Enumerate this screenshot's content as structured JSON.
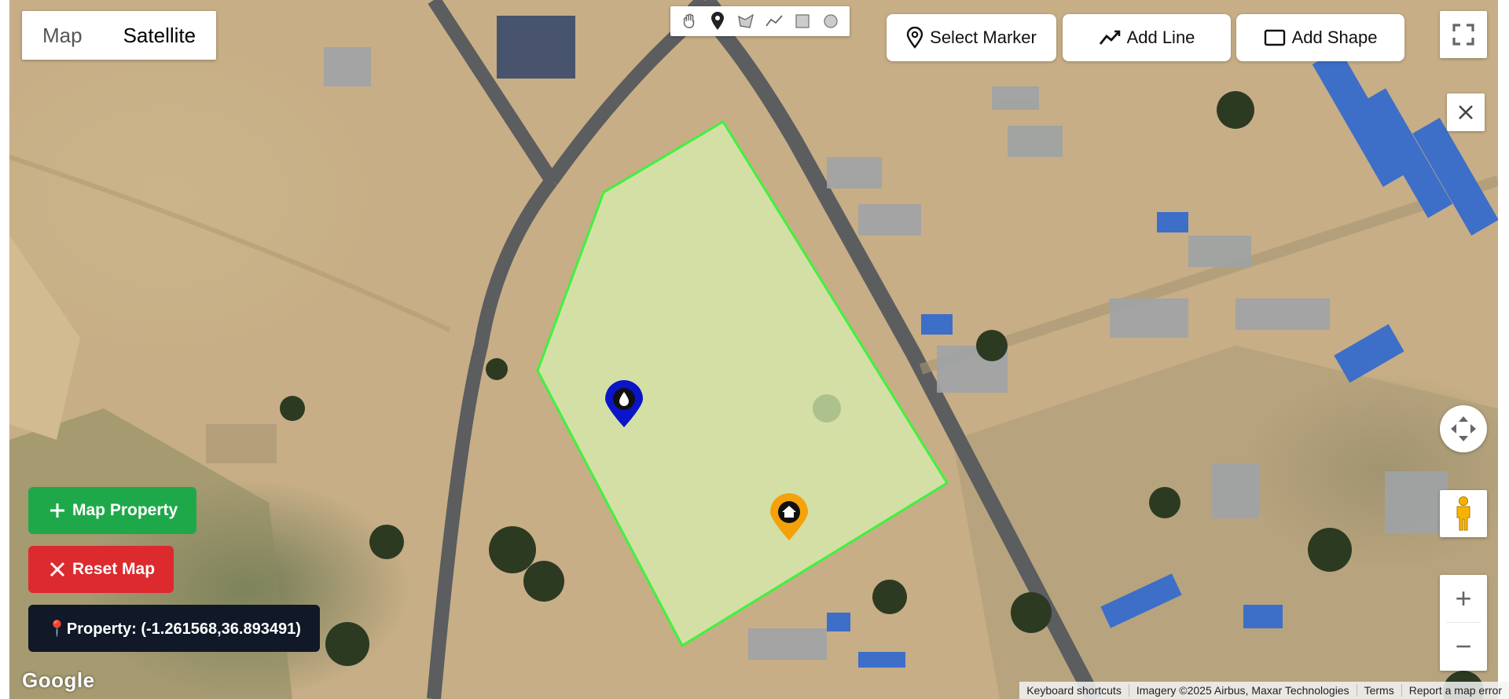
{
  "map_type": {
    "map_label": "Map",
    "satellite_label": "Satellite",
    "selected": "Satellite"
  },
  "draw_tools": [
    "hand-icon",
    "marker-icon",
    "polyline-tool-icon",
    "line-icon",
    "rectangle-icon",
    "circle-icon"
  ],
  "toolbar": {
    "select_marker_label": "Select Marker",
    "add_line_label": "Add Line",
    "add_shape_label": "Add Shape"
  },
  "actions": {
    "map_property_label": "Map Property",
    "reset_map_label": "Reset Map",
    "property_coords": "📍Property: (-1.261568,36.893491)"
  },
  "map_footer": {
    "google": "Google",
    "keyboard_shortcuts": "Keyboard shortcuts",
    "imagery": "Imagery ©2025 Airbus, Maxar Technologies",
    "terms": "Terms",
    "report": "Report a map error"
  },
  "zoom": {
    "in": "+",
    "out": "−"
  },
  "markers": [
    {
      "name": "water-marker",
      "color": "#0a14c8",
      "icon": "drop-icon"
    },
    {
      "name": "home-marker",
      "color": "#f5a10a",
      "icon": "home-icon"
    }
  ],
  "colors": {
    "polygon_stroke": "#3ef23e",
    "polygon_fill": "#d8efb0",
    "green_button": "#1fa84a",
    "red_button": "#dc2a2f",
    "coord_bg": "#111827"
  }
}
